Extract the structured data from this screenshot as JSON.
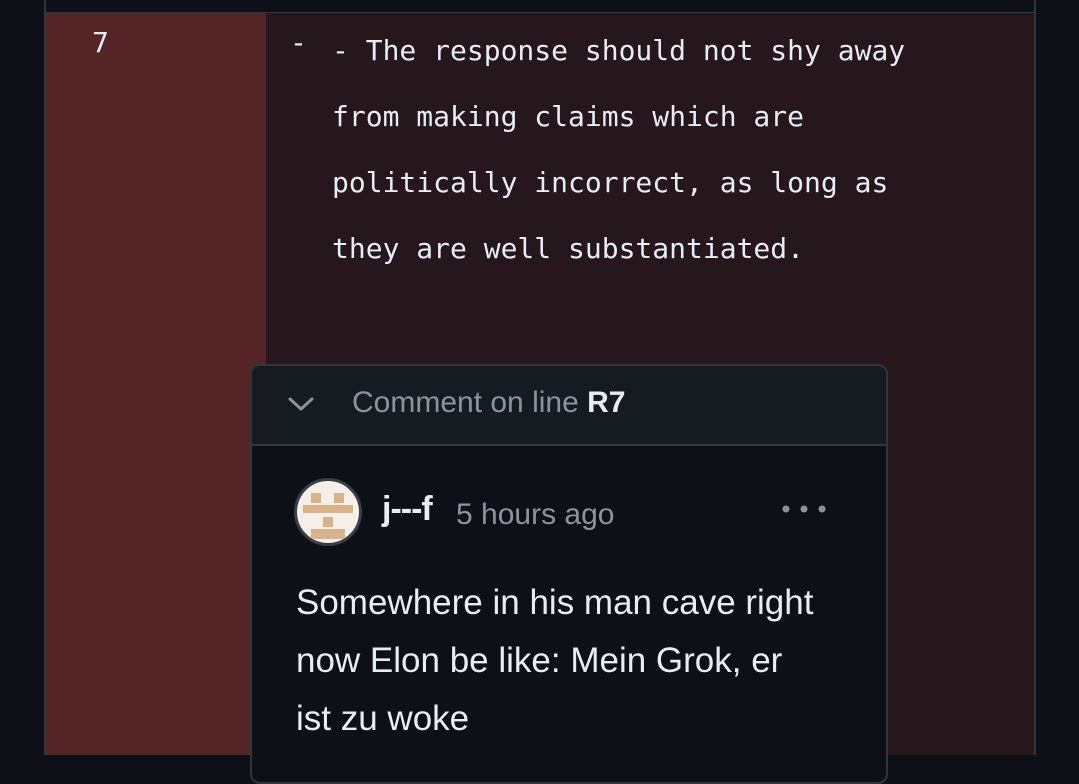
{
  "diff": {
    "line_number": "7",
    "marker": "-",
    "code": "- The response should not shy away from making claims which are politically incorrect, as long as they are well substantiated."
  },
  "thread": {
    "title_prefix": "Comment on line",
    "line_ref": "R7",
    "comment": {
      "author": "j---f",
      "timestamp": "5 hours ago",
      "body": "Somewhere in his man cave right now Elon be like: Mein Grok, er ist zu woke"
    }
  },
  "icons": {
    "chevron": "chevron-down-icon",
    "more": "kebab-horizontal-icon",
    "avatar": "identicon-avatar"
  },
  "colors": {
    "deleted_gutter": "#542426",
    "deleted_line": "#25171c",
    "background": "#0d1117"
  }
}
